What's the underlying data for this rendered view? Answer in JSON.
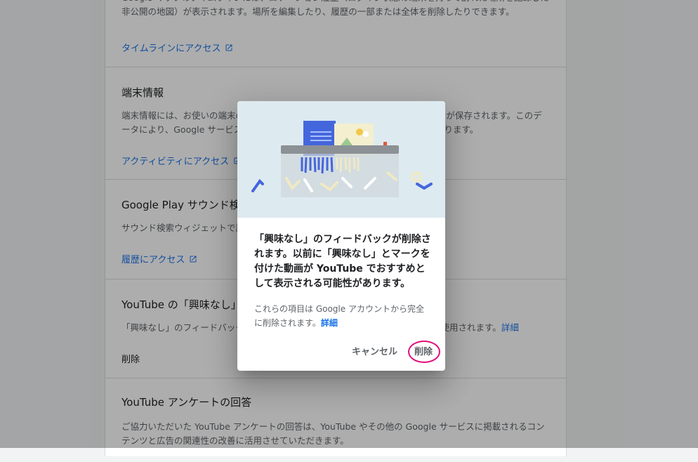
{
  "sections": {
    "timeline": {
      "description": "Google マップのタイムラインには、ロケーション履歴（ログイン状態の端末を持って訪れた場所を記録した非公開の地図）が表示されます。場所を編集したり、履歴の一部または全体を削除したりできます。",
      "link_label": "タイムラインにアクセス"
    },
    "device_info": {
      "title": "端末情報",
      "description": "端末情報には、お使いの端末の連絡先、カレンダー、アプリなどのデータのコピーが保存されます。このデータにより、Google サービス全体でより便利な機能をご利用いただけるようになります。",
      "link_label": "アクティビティにアクセス"
    },
    "google_play_sound": {
      "title": "Google Play サウンド検索の履歴",
      "description": "サウンド検索ウィジェットで識別した曲の履歴が保存されます。",
      "link_label": "履歴にアクセス"
    },
    "youtube_not_interested": {
      "title": "YouTube の「興味なし」のフィードバック",
      "description_before": "「興味なし」のフィードバックは、YouTube のおすすめの動画を改善するために使用されます。",
      "link_label": "詳細",
      "action_label": "削除"
    },
    "youtube_survey": {
      "title": "YouTube アンケートの回答",
      "description": "ご協力いただいた YouTube アンケートの回答は、YouTube やその他の Google サービスに掲載されるコンテンツと広告の関連性の改善に活用させていただきます。"
    }
  },
  "dialog": {
    "message": "「興味なし」のフィードバックが削除されます。以前に「興味なし」とマークを付けた動画が YouTube でおすすめとして表示される可能性があります。",
    "sub_text": "これらの項目は Google アカウントから完全に削除されます。",
    "sub_link": "詳細",
    "cancel_label": "キャンセル",
    "delete_label": "削除"
  },
  "icons": [
    "external-link-icon",
    "shredder-illustration"
  ],
  "colors": {
    "link": "#1a73e8",
    "highlight_circle": "#e0107a",
    "illustration_bg": "#ddeaf0"
  }
}
